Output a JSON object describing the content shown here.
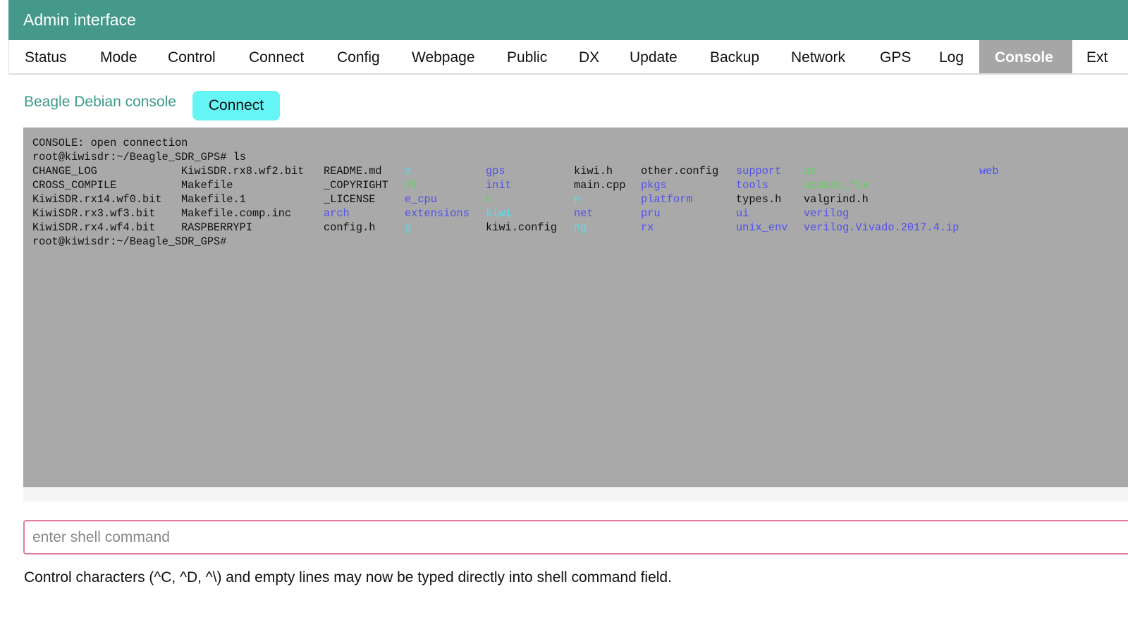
{
  "header": {
    "title": "Admin interface"
  },
  "nav": {
    "tabs": [
      {
        "label": "Status",
        "active": false
      },
      {
        "label": "Mode",
        "active": false
      },
      {
        "label": "Control",
        "active": false
      },
      {
        "label": "Connect",
        "active": false
      },
      {
        "label": "Config",
        "active": false
      },
      {
        "label": "Webpage",
        "active": false
      },
      {
        "label": "Public",
        "active": false
      },
      {
        "label": "DX",
        "active": false
      },
      {
        "label": "Update",
        "active": false
      },
      {
        "label": "Backup",
        "active": false
      },
      {
        "label": "Network",
        "active": false
      },
      {
        "label": "GPS",
        "active": false
      },
      {
        "label": "Log",
        "active": false
      },
      {
        "label": "Console",
        "active": true
      },
      {
        "label": "Ext",
        "active": false
      }
    ]
  },
  "console": {
    "title": "Beagle Debian console",
    "connect_label": "Connect",
    "lines": [
      "CONSOLE: open connection",
      "root@kiwisdr:~/Beagle_SDR_GPS# ls"
    ],
    "ls_rows": [
      [
        {
          "text": "CHANGE_LOG",
          "type": "file"
        },
        {
          "text": "KiwiSDR.rx8.wf2.bit",
          "type": "file"
        },
        {
          "text": "README.md",
          "type": "file"
        },
        {
          "text": "d",
          "type": "link"
        },
        {
          "text": "gps",
          "type": "dir"
        },
        {
          "text": "kiwi.h",
          "type": "file"
        },
        {
          "text": "other.config",
          "type": "file"
        },
        {
          "text": "support",
          "type": "dir"
        },
        {
          "text": "up",
          "type": "exec"
        },
        {
          "text": "web",
          "type": "dir"
        }
      ],
      [
        {
          "text": "CROSS_COMPILE",
          "type": "file"
        },
        {
          "text": "Makefile",
          "type": "file"
        },
        {
          "text": "_COPYRIGHT",
          "type": "file"
        },
        {
          "text": "dl",
          "type": "exec"
        },
        {
          "text": "init",
          "type": "dir"
        },
        {
          "text": "main.cpp",
          "type": "file"
        },
        {
          "text": "pkgs",
          "type": "dir"
        },
        {
          "text": "tools",
          "type": "dir"
        },
        {
          "text": "update_fix",
          "type": "exec"
        }
      ],
      [
        {
          "text": "KiwiSDR.rx14.wf0.bit",
          "type": "file"
        },
        {
          "text": "Makefile.1",
          "type": "file"
        },
        {
          "text": "_LICENSE",
          "type": "file"
        },
        {
          "text": "e_cpu",
          "type": "dir"
        },
        {
          "text": "k",
          "type": "exec"
        },
        {
          "text": "n",
          "type": "link"
        },
        {
          "text": "platform",
          "type": "dir"
        },
        {
          "text": "types.h",
          "type": "file"
        },
        {
          "text": "valgrind.h",
          "type": "file"
        }
      ],
      [
        {
          "text": "KiwiSDR.rx3.wf3.bit",
          "type": "file"
        },
        {
          "text": "Makefile.comp.inc",
          "type": "file"
        },
        {
          "text": "arch",
          "type": "dir"
        },
        {
          "text": "extensions",
          "type": "dir"
        },
        {
          "text": "kiwi",
          "type": "link"
        },
        {
          "text": "net",
          "type": "dir"
        },
        {
          "text": "pru",
          "type": "dir"
        },
        {
          "text": "ui",
          "type": "dir"
        },
        {
          "text": "verilog",
          "type": "dir"
        }
      ],
      [
        {
          "text": "KiwiSDR.rx4.wf4.bit",
          "type": "file"
        },
        {
          "text": "RASPBERRYPI",
          "type": "file"
        },
        {
          "text": "config.h",
          "type": "file"
        },
        {
          "text": "g",
          "type": "link"
        },
        {
          "text": "kiwi.config",
          "type": "file"
        },
        {
          "text": "ng",
          "type": "link"
        },
        {
          "text": "rx",
          "type": "dir"
        },
        {
          "text": "unix_env",
          "type": "dir"
        },
        {
          "text": "verilog.Vivado.2017.4.ip",
          "type": "dir"
        }
      ]
    ],
    "prompt": "root@kiwisdr:~/Beagle_SDR_GPS#"
  },
  "shell_input": {
    "value": "",
    "placeholder": "enter shell command"
  },
  "help_text": "Control characters (^C, ^D, ^\\) and empty lines may now be typed directly into shell command field.",
  "colors": {
    "header_bg": "#44998a",
    "active_tab_bg": "#a6a6a6",
    "connect_button_bg": "#66f5f5",
    "console_bg": "#a9a9a9",
    "directory": "#5050f0",
    "symlink": "#4fe0f0",
    "executable": "#56d856",
    "input_border": "#e37a9e"
  }
}
